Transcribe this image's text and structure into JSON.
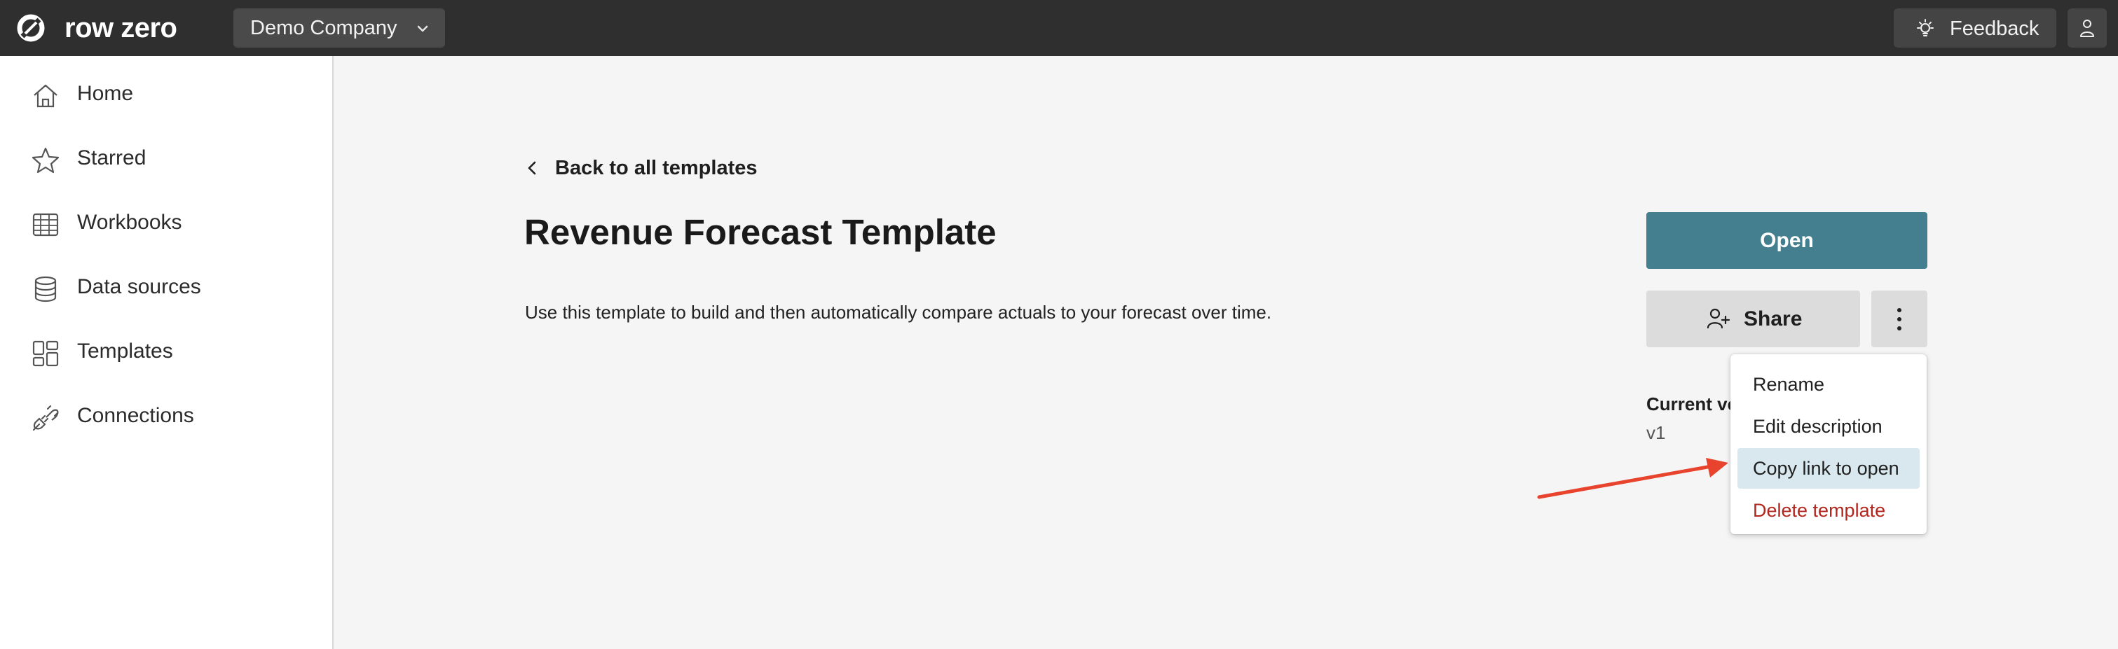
{
  "app": {
    "brand": "row zero",
    "company": "Demo Company",
    "feedback_label": "Feedback"
  },
  "sidebar": {
    "items": [
      {
        "label": "Home",
        "icon": "home-icon"
      },
      {
        "label": "Starred",
        "icon": "star-icon"
      },
      {
        "label": "Workbooks",
        "icon": "table-icon"
      },
      {
        "label": "Data sources",
        "icon": "database-icon"
      },
      {
        "label": "Templates",
        "icon": "templates-icon"
      },
      {
        "label": "Connections",
        "icon": "plug-icon"
      }
    ]
  },
  "main": {
    "back_label": "Back to all templates",
    "title": "Revenue Forecast Template",
    "description": "Use this template to build and then automatically compare actuals to your forecast over time.",
    "open_label": "Open",
    "share_label": "Share",
    "version_label": "Current version",
    "version_value": "v1"
  },
  "menu": {
    "items": [
      {
        "label": "Rename"
      },
      {
        "label": "Edit description"
      },
      {
        "label": "Copy link to open",
        "state": "highlighted"
      },
      {
        "label": "Delete template",
        "state": "destructive"
      }
    ]
  },
  "colors": {
    "topbar": "#2f2f2f",
    "accent": "#437f8f",
    "highlight": "#d8e8ee",
    "danger": "#b3261e",
    "annotation_arrow": "#e8432c"
  }
}
